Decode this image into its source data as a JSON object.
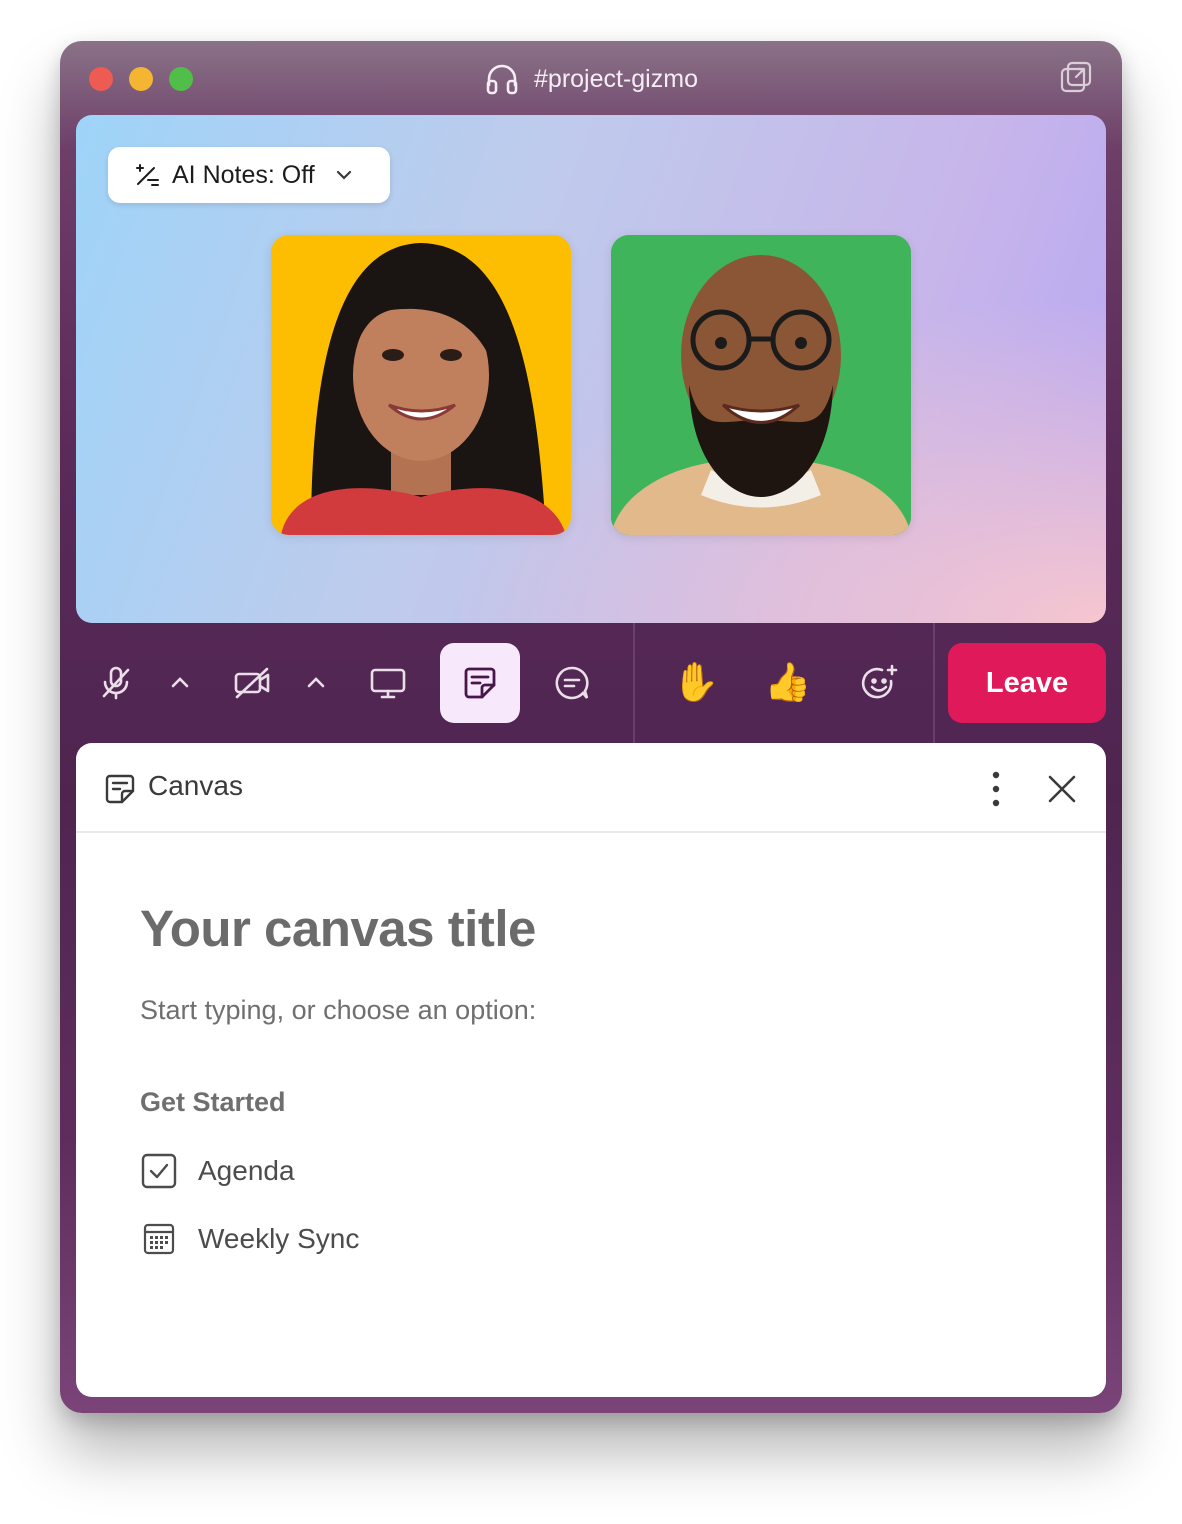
{
  "window": {
    "title": "#project-gizmo",
    "icons": {
      "title": "headphones-icon",
      "popout": "popout-window-icon"
    }
  },
  "huddle": {
    "ai_notes": {
      "label": "AI Notes: Off",
      "icon": "sparkle-pen-icon",
      "caret": "chevron-down-icon"
    },
    "participants": [
      {
        "avatar_bg": "#fdbd00"
      },
      {
        "avatar_bg": "#3fb45b"
      }
    ]
  },
  "controls": {
    "icons": [
      "mic-off-icon",
      "chevron-up-icon",
      "camera-off-icon",
      "chevron-up-icon",
      "screen-share-icon",
      "canvas-icon",
      "thread-icon"
    ],
    "reactions": [
      "✋",
      "👍"
    ],
    "add_reaction_icon": "add-emoji-icon",
    "leave_label": "Leave",
    "leave_color": "#e0195a",
    "active_bg": "#f7e9fb"
  },
  "canvas": {
    "header_title": "Canvas",
    "title_placeholder": "Your canvas title",
    "subtitle": "Start typing, or choose an option:",
    "section_title": "Get Started",
    "options": [
      {
        "label": "Agenda",
        "icon": "checkbox-icon"
      },
      {
        "label": "Weekly Sync",
        "icon": "calendar-icon"
      }
    ]
  }
}
